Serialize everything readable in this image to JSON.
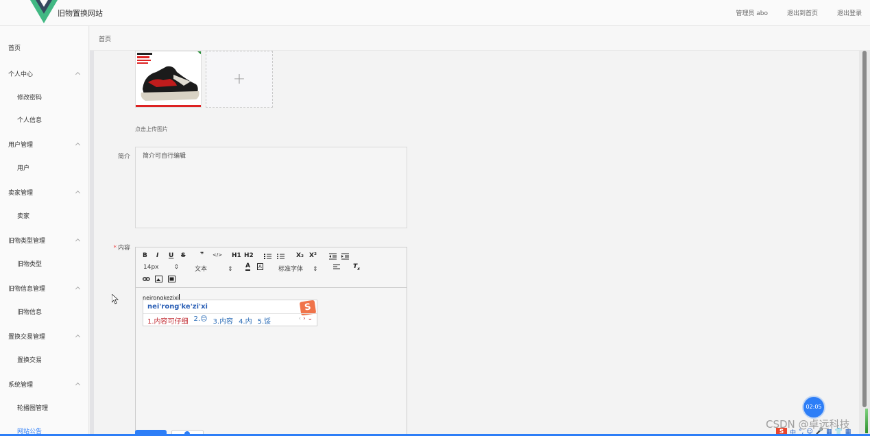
{
  "header": {
    "app_title": "旧物置换网站",
    "links": [
      "管理员 abo",
      "退出到首页",
      "退出登录"
    ],
    "logo_colors": {
      "outer": "#41b883",
      "inner": "#35495e"
    }
  },
  "sidebar": {
    "items": [
      {
        "label": "首页",
        "level": "top",
        "expanded": false
      },
      {
        "label": "个人中心",
        "level": "top",
        "expanded": true
      },
      {
        "label": "修改密码",
        "level": "sub"
      },
      {
        "label": "个人信息",
        "level": "sub"
      },
      {
        "label": "用户管理",
        "level": "top",
        "expanded": true
      },
      {
        "label": "用户",
        "level": "sub"
      },
      {
        "label": "卖家管理",
        "level": "top",
        "expanded": true
      },
      {
        "label": "卖家",
        "level": "sub"
      },
      {
        "label": "旧物类型管理",
        "level": "top",
        "expanded": true
      },
      {
        "label": "旧物类型",
        "level": "sub"
      },
      {
        "label": "旧物信息管理",
        "level": "top",
        "expanded": true
      },
      {
        "label": "旧物信息",
        "level": "sub"
      },
      {
        "label": "置换交易管理",
        "level": "top",
        "expanded": true
      },
      {
        "label": "置换交易",
        "level": "sub"
      },
      {
        "label": "系统管理",
        "level": "top",
        "expanded": true
      },
      {
        "label": "轮播图管理",
        "level": "sub"
      },
      {
        "label": "网站公告",
        "level": "sub",
        "active": true
      }
    ]
  },
  "breadcrumb": {
    "current": "首页"
  },
  "form": {
    "upload_hint": "点击上传图片",
    "upload_icon": "plus-icon",
    "intro_label": "简介",
    "intro_value": "简介可自行编辑",
    "content_label": "内容",
    "content_required_mark": "*"
  },
  "editor": {
    "toolbar_row1": [
      "B",
      "I",
      "U",
      "S",
      "❞",
      "</>",
      "H1",
      "H2",
      "ordered-list-icon",
      "bullet-list-icon",
      "X₂",
      "X²",
      "outdent-icon",
      "indent-icon"
    ],
    "size_value": "14px",
    "header_value": "文本",
    "font_value": "标准字体",
    "toolbar_row3": [
      "link-icon",
      "image-icon",
      "video-icon"
    ],
    "typed_text": "neirongkezixi"
  },
  "ime": {
    "pinyin": "nei'rong'ke'zi'xi",
    "candidates": [
      "1.内容可仔细",
      "2.😊",
      "3.内容",
      "4.内",
      "5.馁"
    ],
    "logo": "S"
  },
  "timer": {
    "value": "02:05"
  },
  "watermark": {
    "text": "CSDN @卓远科技"
  },
  "tray": {
    "items": [
      "中",
      "°,",
      "☺",
      "🎤",
      "▦",
      "👕",
      "▦"
    ]
  },
  "colors": {
    "accent": "#2d7ef7",
    "required": "#e44444",
    "ime_red": "#c0282f"
  }
}
